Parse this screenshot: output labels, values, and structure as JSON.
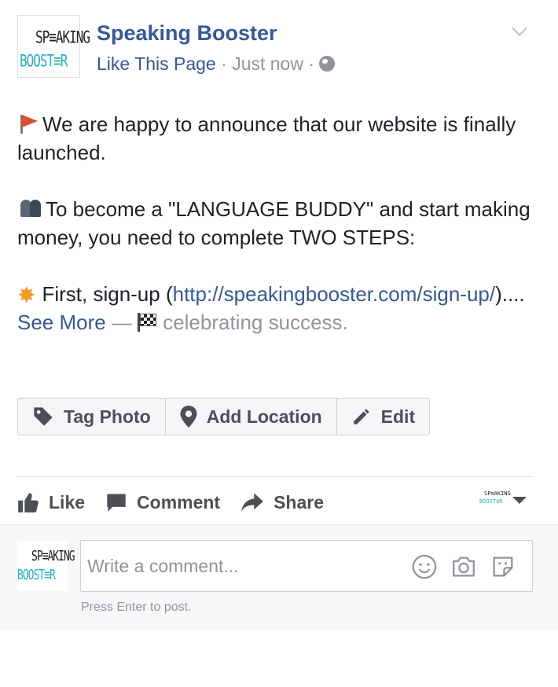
{
  "post": {
    "page_name": "Speaking Booster",
    "logo_top": "SP≡AKING",
    "logo_bottom": "BOOST≡R",
    "like_link": "Like This Page",
    "separator": " · ",
    "timestamp": "Just now",
    "body": {
      "line1": "We are happy to announce that our website is finally launched.",
      "line2": "To become a \"LANGUAGE BUDDY\" and start making money, you need to complete TWO STEPS:",
      "line3_prefix": "First, sign-up (",
      "line3_url": "http://speakingbooster.com/sign-up/",
      "line3_suffix": ")....",
      "see_more": "See More",
      "dash": " — ",
      "feeling": "celebrating success."
    }
  },
  "toolbar": {
    "tag_photo": "Tag Photo",
    "add_location": "Add Location",
    "edit": "Edit"
  },
  "actions": {
    "like": "Like",
    "comment": "Comment",
    "share": "Share",
    "actor_logo_top": "SP≡AKING",
    "actor_logo_bottom": "BOOST≡R"
  },
  "comment": {
    "placeholder": "Write a comment...",
    "hint": "Press Enter to post.",
    "logo_top": "SP≡AKING",
    "logo_bottom": "BOOST≡R"
  },
  "colors": {
    "link": "#365899",
    "muted": "#90949c",
    "text": "#1d2129",
    "logo_teal": "#2ab0c2"
  }
}
